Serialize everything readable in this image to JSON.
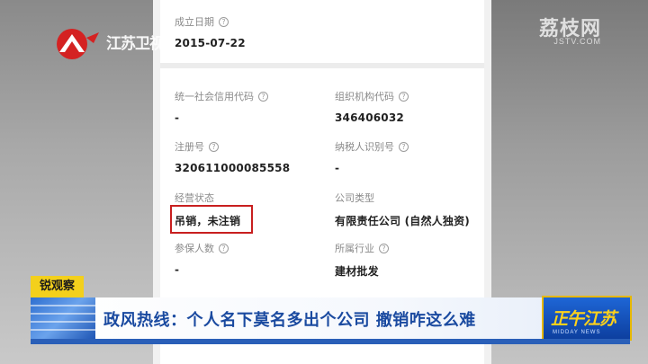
{
  "station": {
    "logo_text": "江苏卫视"
  },
  "watermark": {
    "title": "荔枝网",
    "subtitle": "JSTV.COM"
  },
  "fields": {
    "established_date": {
      "label": "成立日期",
      "value": "2015-07-22"
    },
    "unified_credit_code": {
      "label": "统一社会信用代码",
      "value": "-"
    },
    "org_code": {
      "label": "组织机构代码",
      "value": "346406032"
    },
    "registration_no": {
      "label": "注册号",
      "value": "320611000085558"
    },
    "taxpayer_id": {
      "label": "纳税人识别号",
      "value": "-"
    },
    "business_status": {
      "label": "经营状态",
      "value": "吊销，未注销"
    },
    "company_type": {
      "label": "公司类型",
      "value": "有限责任公司 (自然人独资)"
    },
    "insured_count": {
      "label": "参保人数",
      "value": "-"
    },
    "industry": {
      "label": "所属行业",
      "value": "建材批发"
    }
  },
  "help_icon_glyph": "?",
  "lower_third": {
    "tag": "锐观察",
    "headline": "政风热线：个人名下莫名多出个公司 撤销咋这么难",
    "show_logo": "正午江苏",
    "show_logo_sub": "MIDDAY NEWS"
  },
  "colors": {
    "highlight": "#c81f1f",
    "tag_bg": "#f3d01c",
    "headline_text": "#1a4aa0"
  }
}
